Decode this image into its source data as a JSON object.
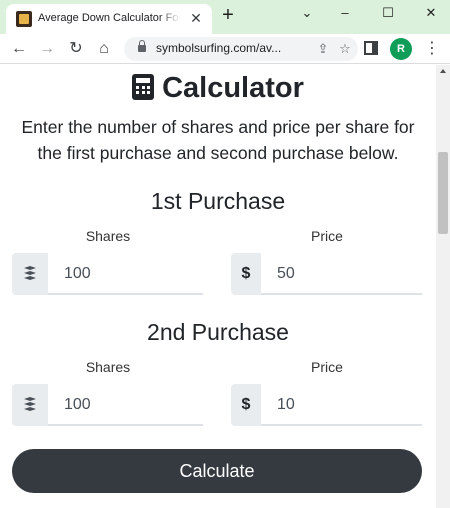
{
  "browser": {
    "tab_title": "Average Down Calculator For",
    "tab_close": "✕",
    "new_tab": "+",
    "window_controls": {
      "minimize": "–",
      "maximize": "☐",
      "close": "✕",
      "tab_search": "⌄"
    },
    "url": "symbolsurfing.com/av...",
    "profile_initial": "R",
    "nav": {
      "back": "←",
      "forward": "→",
      "reload": "↻",
      "home": "⌂"
    },
    "icons": [
      "tab-favicon-icon",
      "lock-icon",
      "share-icon",
      "star-icon",
      "side-panel-icon",
      "kebab-menu-icon"
    ]
  },
  "page": {
    "title": "Calculator",
    "description": "Enter the number of shares and price per share for the first purchase and second purchase below.",
    "purchases": [
      {
        "heading": "1st Purchase",
        "shares_label": "Shares",
        "price_label": "Price",
        "shares_value": "100",
        "price_value": "50",
        "price_prefix": "$"
      },
      {
        "heading": "2nd Purchase",
        "shares_label": "Shares",
        "price_label": "Price",
        "shares_value": "100",
        "price_value": "10",
        "price_prefix": "$"
      }
    ],
    "calculate_label": "Calculate"
  },
  "colors": {
    "tabstrip": "#dcf1dc",
    "button": "#343a40",
    "addon": "#e9ecef",
    "avatar": "#0f9d58"
  }
}
